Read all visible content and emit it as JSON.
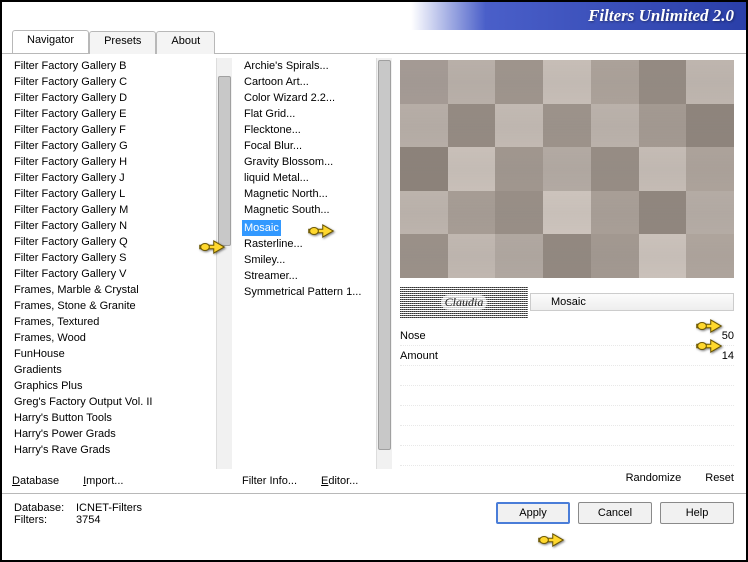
{
  "app_title": "Filters Unlimited 2.0",
  "tabs": [
    "Navigator",
    "Presets",
    "About"
  ],
  "active_tab": 0,
  "categories": [
    "Filter Factory Gallery B",
    "Filter Factory Gallery C",
    "Filter Factory Gallery D",
    "Filter Factory Gallery E",
    "Filter Factory Gallery F",
    "Filter Factory Gallery G",
    "Filter Factory Gallery H",
    "Filter Factory Gallery J",
    "Filter Factory Gallery L",
    "Filter Factory Gallery M",
    "Filter Factory Gallery N",
    "Filter Factory Gallery Q",
    "Filter Factory Gallery S",
    "Filter Factory Gallery V",
    "Frames, Marble & Crystal",
    "Frames, Stone & Granite",
    "Frames, Textured",
    "Frames, Wood",
    "FunHouse",
    "Gradients",
    "Graphics Plus",
    "Greg's Factory Output Vol. II",
    "Harry's Button Tools",
    "Harry's Power Grads",
    "Harry's Rave Grads"
  ],
  "selected_category_index": 11,
  "filters": [
    "Archie's Spirals...",
    "Cartoon Art...",
    "Color Wizard 2.2...",
    "Flat Grid...",
    "Flecktone...",
    "Focal Blur...",
    "Gravity Blossom...",
    "liquid Metal...",
    "Magnetic North...",
    "Magnetic South...",
    "Mosaic",
    "Rasterline...",
    "Smiley...",
    "Streamer...",
    "Symmetrical Pattern 1..."
  ],
  "selected_filter_index": 10,
  "watermark_text": "Claudia",
  "current_filter_name": "Mosaic",
  "params": [
    {
      "label": "Nose",
      "value": 50
    },
    {
      "label": "Amount",
      "value": 14
    }
  ],
  "left_buttons": {
    "database": "Database",
    "import": "Import..."
  },
  "mid_buttons": {
    "filterinfo": "Filter Info...",
    "editor": "Editor..."
  },
  "right_buttons": {
    "randomize": "Randomize",
    "reset": "Reset"
  },
  "status": {
    "db_label": "Database:",
    "db_value": "ICNET-Filters",
    "filters_label": "Filters:",
    "filters_value": "3754"
  },
  "bottom_buttons": {
    "apply": "Apply",
    "cancel": "Cancel",
    "help": "Help"
  },
  "preview_colors": [
    "#a49a94",
    "#b8afa8",
    "#9e948c",
    "#c6bdb6",
    "#aba199",
    "#948a82",
    "#beb5ae",
    "#b6ada6",
    "#948a82",
    "#c2b9b2",
    "#9c928a",
    "#bab1aa",
    "#a39991",
    "#8e847c",
    "#8c827a",
    "#c8bfb8",
    "#a0968e",
    "#b2a9a2",
    "#968c84",
    "#c4bbb4",
    "#aca29a",
    "#bcb3ac",
    "#a69c94",
    "#988e86",
    "#ccc3bc",
    "#a89e96",
    "#90867e",
    "#b4aba4",
    "#9a9088",
    "#c0b7b0",
    "#b0a7a0",
    "#928880",
    "#a29890",
    "#cac1ba",
    "#aea49c"
  ]
}
